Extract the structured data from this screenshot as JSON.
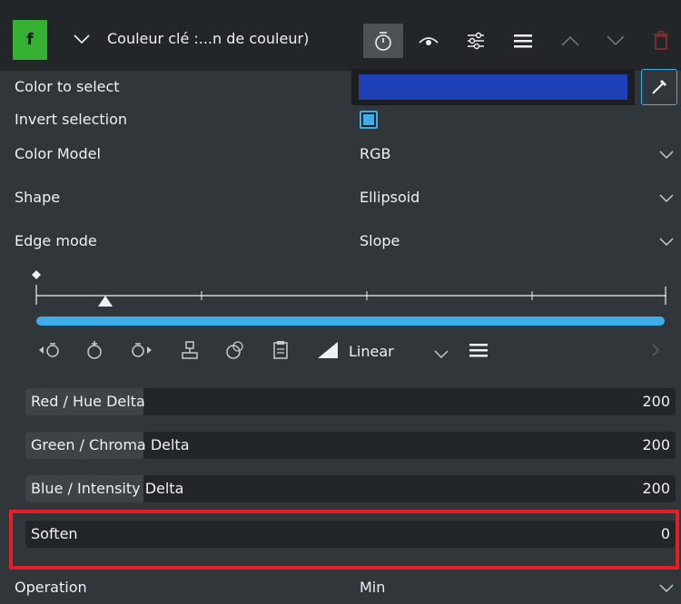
{
  "header": {
    "badge": "f",
    "title": "Couleur clé :...n de couleur)",
    "icons": [
      "timer-icon",
      "eye-icon",
      "sliders-icon",
      "hamburger-menu-icon",
      "chevron-up-icon",
      "chevron-down-icon",
      "trash-icon"
    ]
  },
  "params": {
    "color_to_select": {
      "label": "Color to select",
      "value": "#1e3fb5"
    },
    "invert_selection": {
      "label": "Invert selection",
      "checked": true
    },
    "color_model": {
      "label": "Color Model",
      "value": "RGB"
    },
    "shape": {
      "label": "Shape",
      "value": "Ellipsoid"
    },
    "edge_mode": {
      "label": "Edge mode",
      "value": "Slope"
    },
    "operation": {
      "label": "Operation",
      "value": "Min"
    }
  },
  "keyframes": {
    "interpolation": "Linear",
    "icons": [
      "previous-keyframe-icon",
      "add-keyframe-icon",
      "next-keyframe-icon",
      "keyframe-at-cursor-icon",
      "copy-keyframe-icon",
      "paste-keyframe-icon",
      "interpolation-icon",
      "hamburger-menu-icon",
      "chevron-right-icon"
    ]
  },
  "sliders": [
    {
      "label": "Red / Hue Delta",
      "value": "200",
      "fill_fraction": 0.2
    },
    {
      "label": "Green / Chroma Delta",
      "value": "200",
      "fill_fraction": 0.2
    },
    {
      "label": "Blue / Intensity Delta",
      "value": "200",
      "fill_fraction": 0.2
    },
    {
      "label": "Soften",
      "value": "0",
      "fill_fraction": 0.0
    }
  ],
  "colors": {
    "background": "#31363b",
    "header": "#232629",
    "accent": "#3daee9",
    "effect_badge": "#36b030",
    "highlight_border": "#e51f2a",
    "selected_color": "#1e3fb5"
  }
}
